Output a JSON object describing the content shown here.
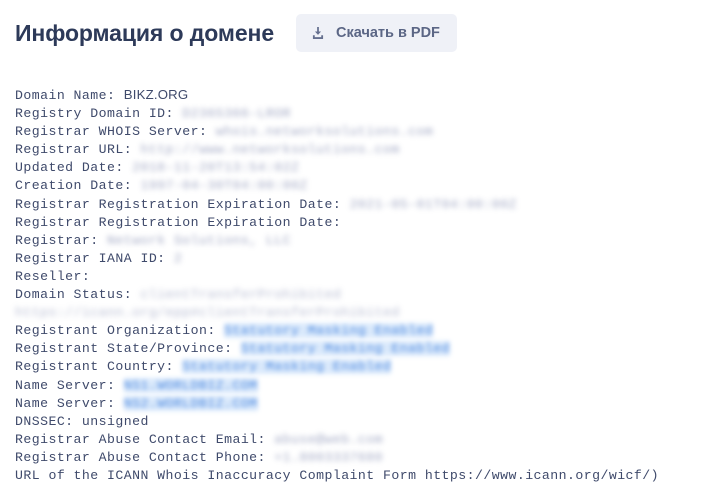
{
  "header": {
    "title": "Информация о домене",
    "download_button_label": "Скачать в PDF",
    "download_icon": "download-tray-icon"
  },
  "colors": {
    "title": "#2d3a59",
    "button_bg": "#eff1f7",
    "button_text": "#5b6685",
    "body_text": "#3f4a6b",
    "highlight_text": "#3b7ddd",
    "highlight_bg": "#d6e7fb",
    "page_bg": "#ffffff"
  },
  "whois": {
    "lines": [
      {
        "label": "Domain Name: ",
        "value": "BIKZ.ORG",
        "style": "plain"
      },
      {
        "label": "Registry Domain ID: ",
        "value": "D2365366-LROR",
        "style": "blur"
      },
      {
        "label": "Registrar WHOIS Server: ",
        "value": "whois.networksolutions.com",
        "style": "blur"
      },
      {
        "label": "Registrar URL: ",
        "value": "http://www.networksolutions.com",
        "style": "blur"
      },
      {
        "label": "Updated Date: ",
        "value": "2018-11-20T13:54:02Z",
        "style": "blur"
      },
      {
        "label": "Creation Date: ",
        "value": "1997-04-30T04:00:00Z",
        "style": "blur"
      },
      {
        "label": "Registrar Registration Expiration Date: ",
        "value": "2021-05-01T04:00:00Z",
        "style": "blur"
      },
      {
        "label": "Registrar Registration Expiration Date: ",
        "value": "",
        "style": "none"
      },
      {
        "label": "Registrar: ",
        "value": "Network Solutions, LLC",
        "style": "blur"
      },
      {
        "label": "Registrar IANA ID: ",
        "value": "2",
        "style": "blur"
      },
      {
        "label": "Reseller: ",
        "value": "",
        "style": "none"
      },
      {
        "label": "Domain Status: ",
        "value": "clientTransferProhibited https://icann.org/epp#clientTransferProhibited",
        "style": "blur-soft"
      },
      {
        "label": "Registrant Organization: ",
        "value": "Statutory Masking Enabled",
        "style": "blur-hl"
      },
      {
        "label": "Registrant State/Province: ",
        "value": "Statutory Masking Enabled",
        "style": "blur-hl"
      },
      {
        "label": "Registrant Country: ",
        "value": "Statutory Masking Enabled",
        "style": "blur-hl"
      },
      {
        "label": "Name Server: ",
        "value": "NS1.WORLDBIZ.COM",
        "style": "blur-hl"
      },
      {
        "label": "Name Server: ",
        "value": "NS2.WORLDBIZ.COM",
        "style": "blur-hl"
      },
      {
        "label": "DNSSEC: unsigned",
        "value": "",
        "style": "none"
      },
      {
        "label": "Registrar Abuse Contact Email: ",
        "value": "abuse@web.com",
        "style": "blur"
      },
      {
        "label": "Registrar Abuse Contact Phone: ",
        "value": "+1.8003337680",
        "style": "blur"
      },
      {
        "label": "URL of the ICANN Whois Inaccuracy Complaint Form https://www.icann.org/wicf/)",
        "value": "",
        "style": "none"
      }
    ]
  }
}
